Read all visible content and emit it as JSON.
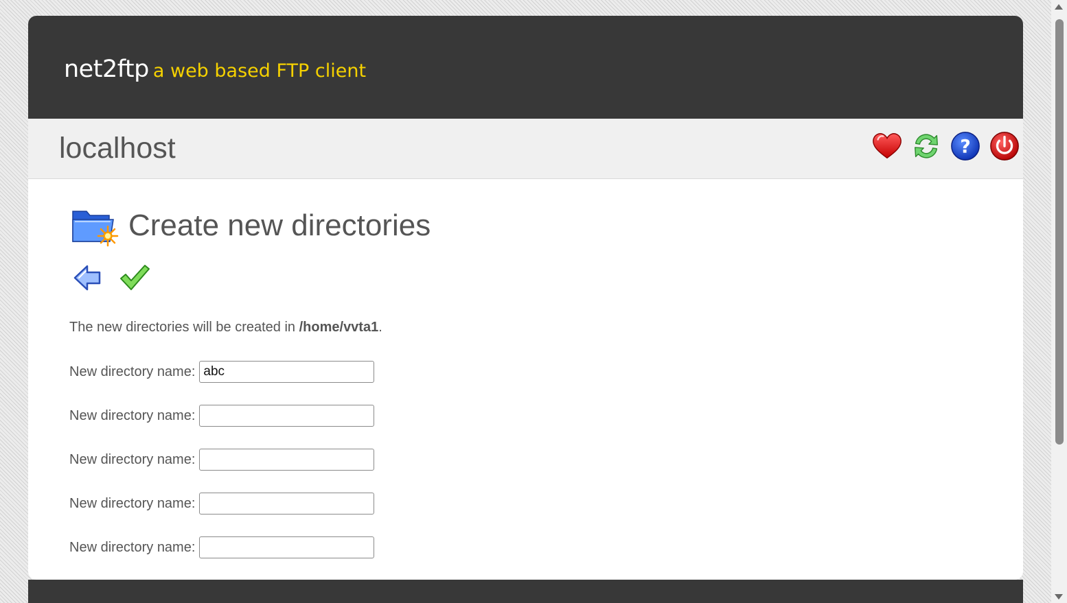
{
  "header": {
    "brand_name": "net2ftp",
    "brand_tagline": "a web based FTP client"
  },
  "serverbar": {
    "server_name": "localhost",
    "icons": [
      "bookmark-heart-icon",
      "refresh-icon",
      "help-icon",
      "logout-power-icon"
    ]
  },
  "main": {
    "title": "Create new directories",
    "title_icon": "new-folder-icon",
    "actions": [
      "back-arrow-icon",
      "submit-check-icon"
    ],
    "info_prefix": "The new directories will be created in ",
    "info_path": "/home/vvta1",
    "info_suffix": ".",
    "fields": [
      {
        "label": "New directory name:",
        "value": "abc"
      },
      {
        "label": "New directory name:",
        "value": ""
      },
      {
        "label": "New directory name:",
        "value": ""
      },
      {
        "label": "New directory name:",
        "value": ""
      },
      {
        "label": "New directory name:",
        "value": ""
      }
    ]
  },
  "colors": {
    "header_bg": "#383838",
    "tagline": "#f5d100",
    "serverbar_bg": "#f0f0f0",
    "text": "#555555"
  }
}
